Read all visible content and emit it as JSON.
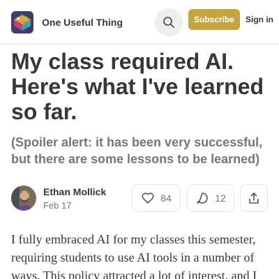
{
  "header": {
    "publication_name": "One Useful Thing",
    "subscribe_label": "Subscribe",
    "signin_label": "Sign in",
    "accent_color": "#c4a541"
  },
  "post": {
    "title": "My class required AI. Here's what I've learned so far.",
    "subtitle": "(Spoiler alert: it has been very successful, but there are some lessons to be learned)",
    "author": "Ethan Mollick",
    "date": "Feb 17",
    "likes": "84",
    "comments": "12",
    "body_start": "I fully embraced AI for my classes this semester, requiring students to use AI tools in a number of ways. This policy attracted a lot of interest, and I"
  },
  "icons": {
    "search": "search-icon",
    "like": "heart-icon",
    "comment": "comment-icon",
    "share": "share-icon"
  }
}
